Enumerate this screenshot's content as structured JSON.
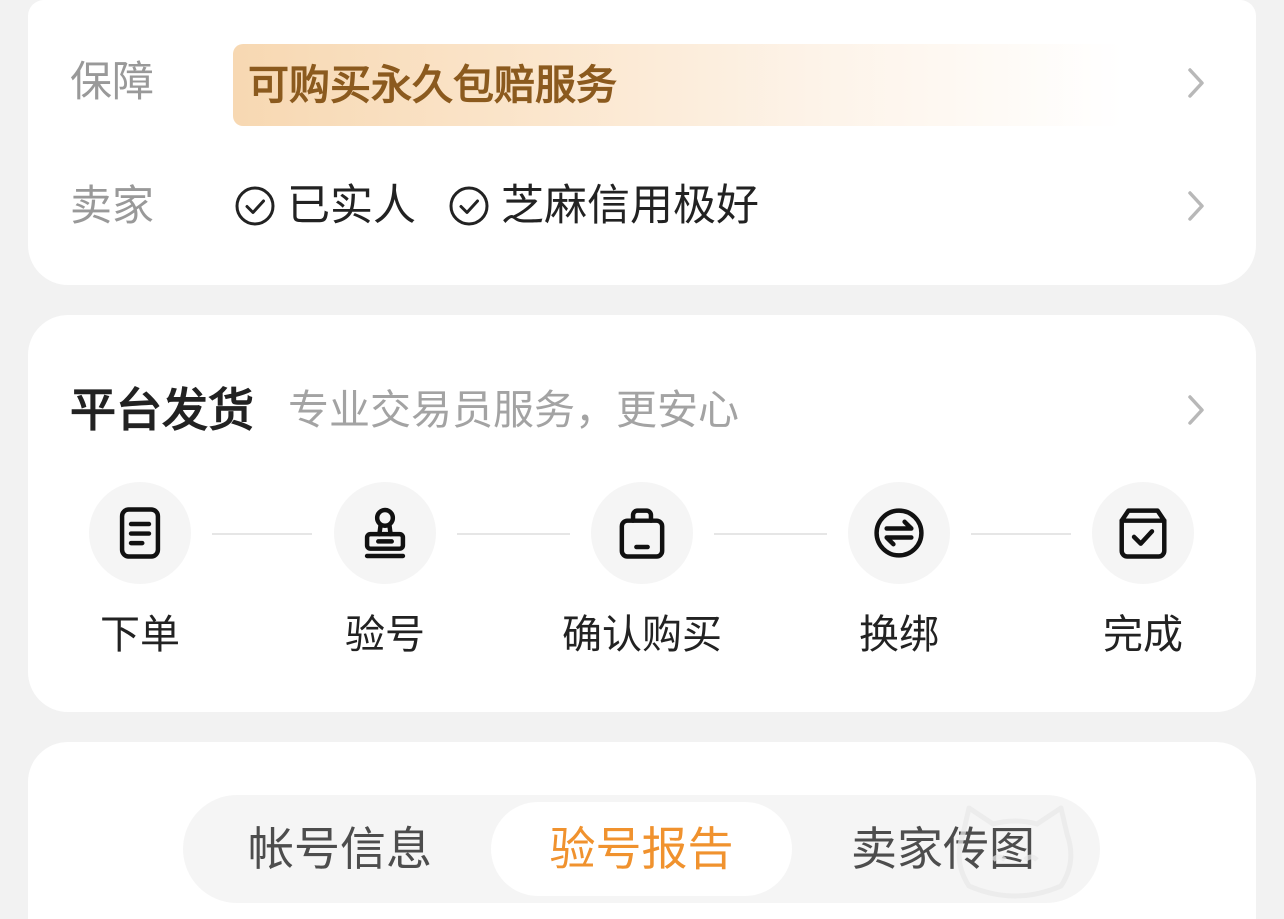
{
  "guarantee": {
    "label": "保障",
    "text": "可购买永久包赔服务"
  },
  "seller": {
    "label": "卖家",
    "badges": [
      {
        "text": "已实人",
        "icon": "check-circle-icon"
      },
      {
        "text": "芝麻信用极好",
        "icon": "check-circle-icon"
      }
    ]
  },
  "platform_shipping": {
    "title": "平台发货",
    "subtitle": "专业交易员服务，更安心",
    "steps": [
      {
        "label": "下单",
        "icon": "document-icon"
      },
      {
        "label": "验号",
        "icon": "stamp-icon"
      },
      {
        "label": "确认购买",
        "icon": "shopping-bag-icon"
      },
      {
        "label": "换绑",
        "icon": "exchange-icon"
      },
      {
        "label": "完成",
        "icon": "box-check-icon"
      }
    ]
  },
  "detail_tabs": [
    {
      "label": "帐号信息",
      "active": false
    },
    {
      "label": "验号报告",
      "active": true
    },
    {
      "label": "卖家传图",
      "active": false
    }
  ],
  "icons": {
    "row_chevron": "chevron-right-icon"
  },
  "colors": {
    "page_background": "#f2f2f2",
    "accent": "#f0922e",
    "guarantee_text": "#8b5a1e",
    "guarantee_banner_start": "#f7d8b2",
    "muted_text": "#999999"
  }
}
